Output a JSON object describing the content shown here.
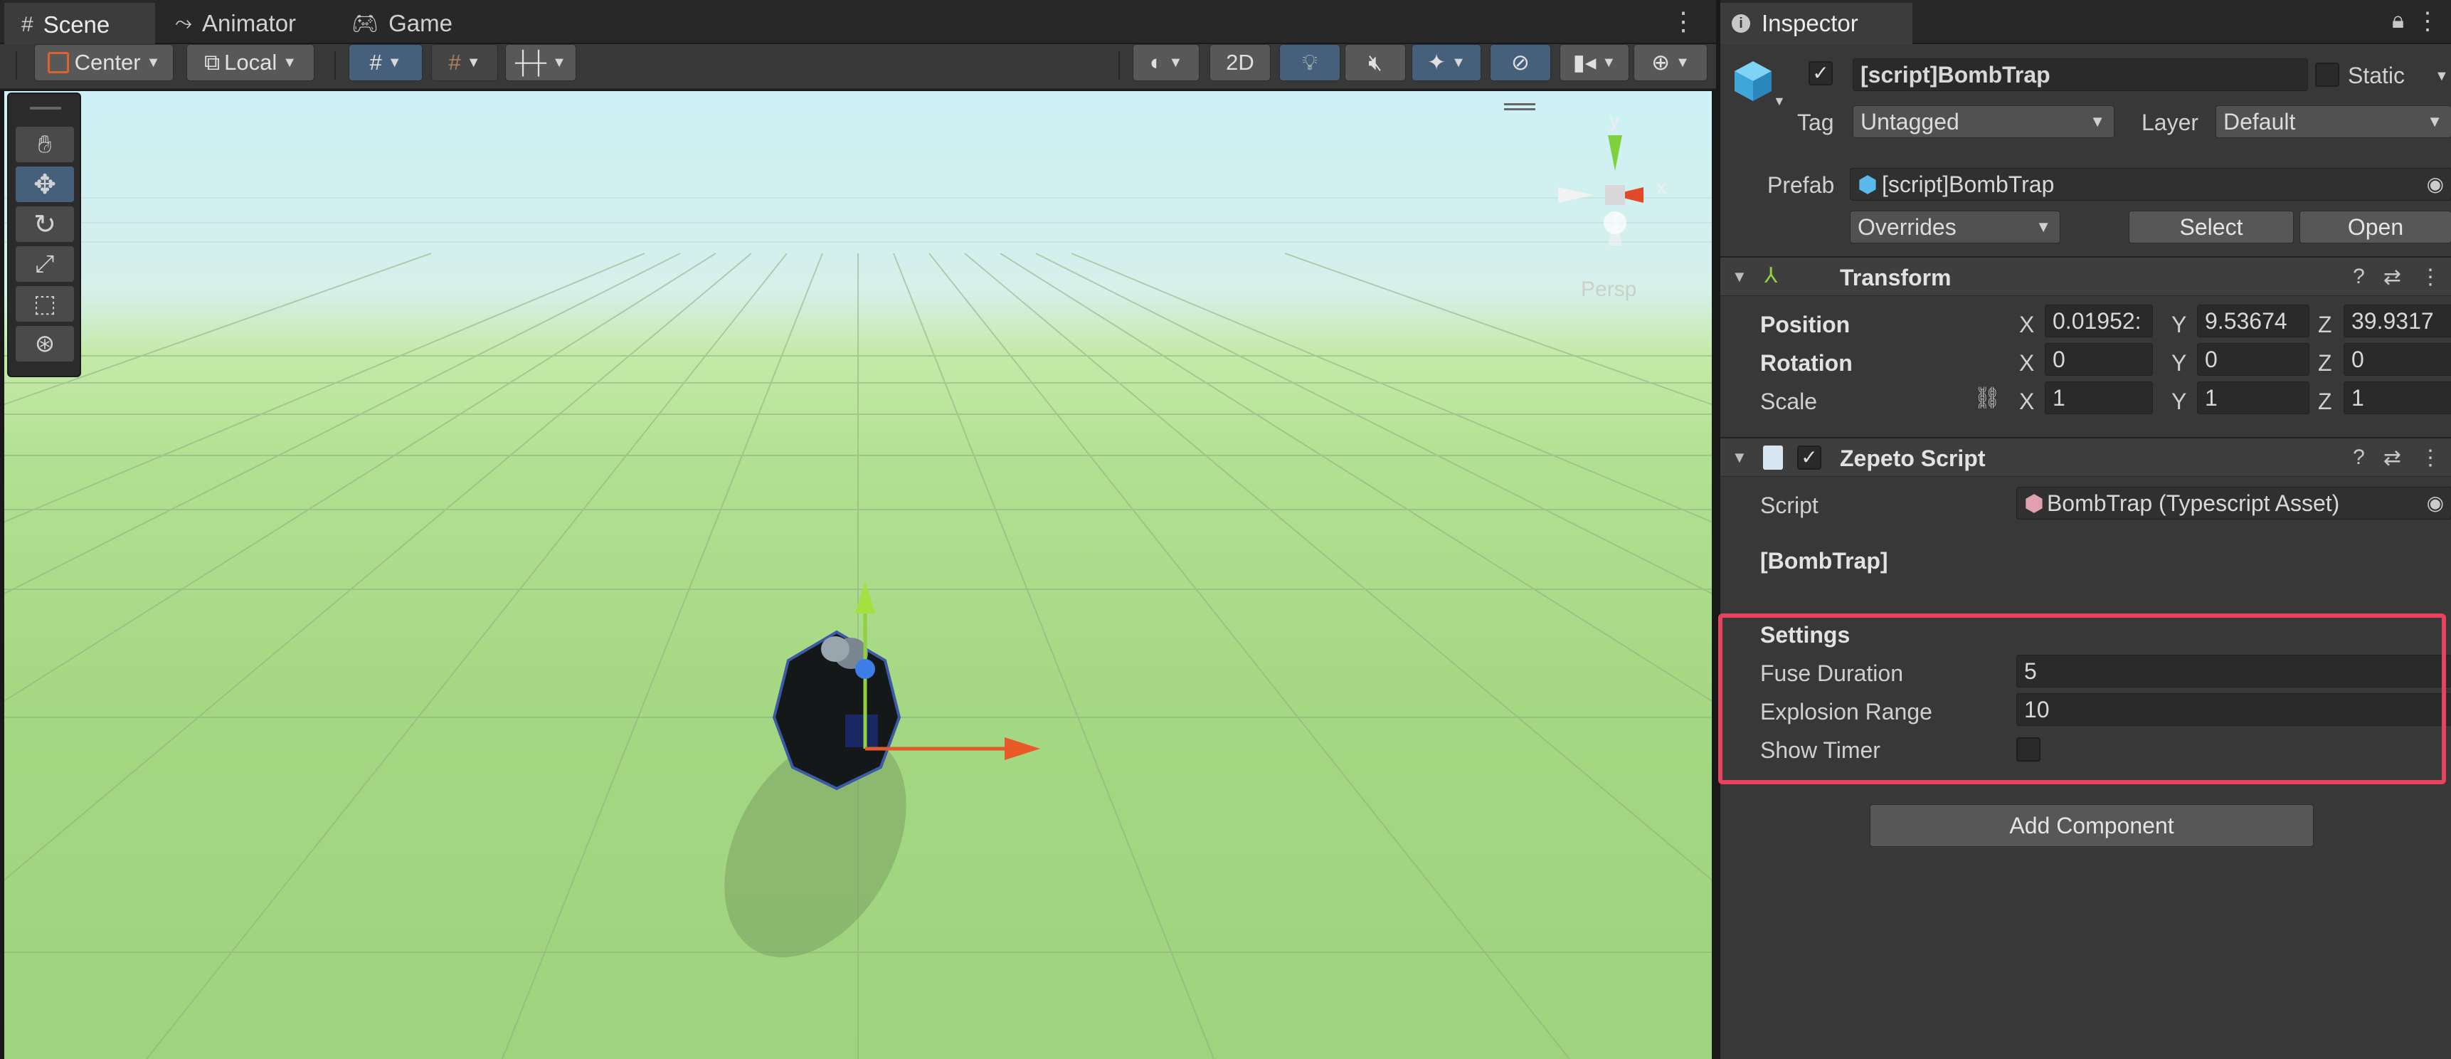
{
  "scene_tabs": [
    {
      "label": "Scene",
      "icon": "grid-icon"
    },
    {
      "label": "Animator",
      "icon": "animator-icon"
    },
    {
      "label": "Game",
      "icon": "gamepad-icon"
    }
  ],
  "scene_toolbar": {
    "pivot": "Center",
    "space": "Local",
    "mode_2d": "2D"
  },
  "viewport": {
    "camera_mode": "Persp",
    "gizmo_axes": [
      "y",
      "x"
    ]
  },
  "inspector": {
    "tab": "Inspector",
    "object_name": "[script]BombTrap",
    "static_label": "Static",
    "tag_label": "Tag",
    "tag_value": "Untagged",
    "layer_label": "Layer",
    "layer_value": "Default",
    "prefab_label": "Prefab",
    "prefab_value": "[script]BombTrap",
    "overrides": "Overrides",
    "select_button": "Select",
    "open_button": "Open",
    "transform": {
      "title": "Transform",
      "position_label": "Position",
      "rotation_label": "Rotation",
      "scale_label": "Scale",
      "position": {
        "x": "0.01952:",
        "y": "9.53674",
        "z": "39.9317"
      },
      "rotation": {
        "x": "0",
        "y": "0",
        "z": "0"
      },
      "scale": {
        "x": "1",
        "y": "1",
        "z": "1"
      }
    },
    "zepeto_script": {
      "title": "Zepeto Script",
      "script_label": "Script",
      "script_value": "BombTrap (Typescript Asset)",
      "class_name": "[BombTrap]"
    },
    "settings": {
      "title": "Settings",
      "fuse_label": "Fuse Duration",
      "fuse_value": "5",
      "range_label": "Explosion Range",
      "range_value": "10",
      "timer_label": "Show Timer"
    },
    "add_component": "Add Component"
  },
  "accent": {
    "highlight": "#e8425c",
    "active_button": "#46607c"
  }
}
